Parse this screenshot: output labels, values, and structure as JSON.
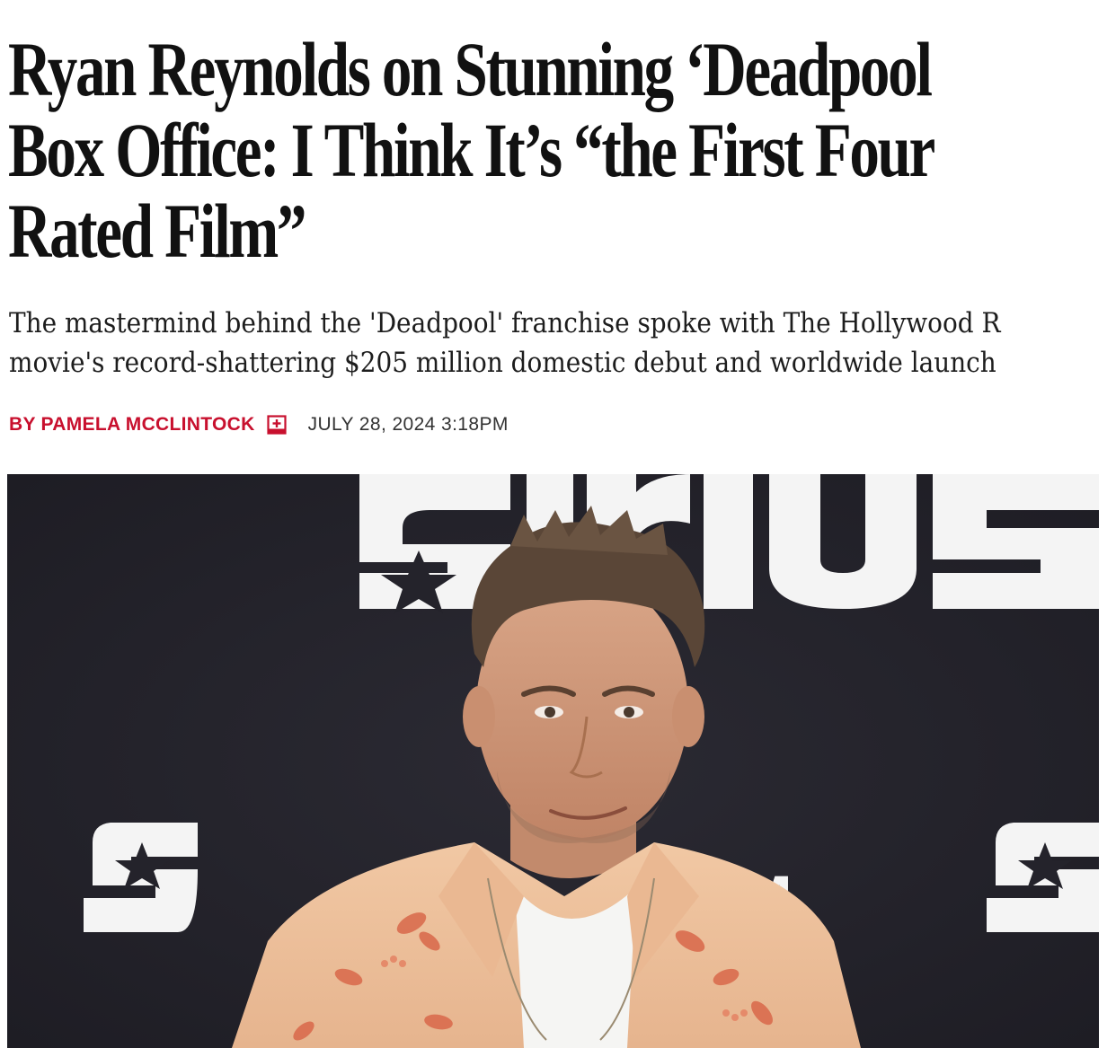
{
  "article": {
    "headline_lines": [
      "Ryan Reynolds on Stunning ‘Deadpool",
      "Box Office: I Think It’s “the First Four",
      "Rated Film”"
    ],
    "dek_lines": [
      "The mastermind behind the 'Deadpool' franchise spoke with The Hollywood R",
      "movie's record-shattering $205 million domestic debut and worldwide launch"
    ],
    "byline": {
      "author": "By Pamela McClintock",
      "follow_icon": "plus-box-icon",
      "date": "JULY 28, 2024 3:18PM"
    },
    "hero_image": {
      "backdrop_text": "SiriusXM",
      "alt": "Ryan Reynolds"
    }
  },
  "colors": {
    "accent": "#c8102e",
    "text": "#111111",
    "backdrop": "#24232b"
  }
}
